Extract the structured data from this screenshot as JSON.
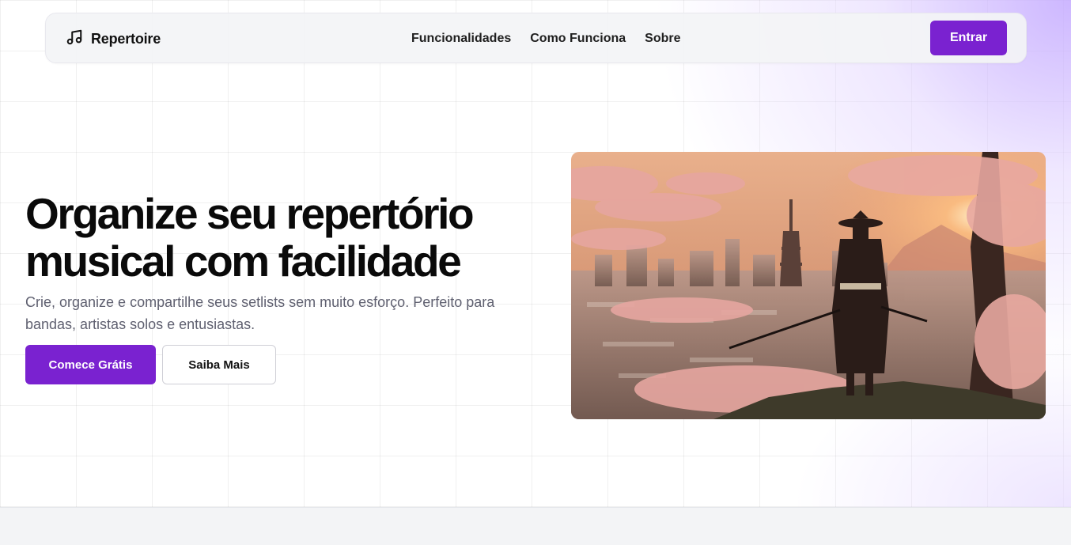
{
  "navbar": {
    "brand_icon": "music-note-icon",
    "brand_name": "Repertoire",
    "links": [
      {
        "label": "Funcionalidades"
      },
      {
        "label": "Como Funciona"
      },
      {
        "label": "Sobre"
      }
    ],
    "login_label": "Entrar"
  },
  "hero": {
    "headline_line1": "Organize seu repertório",
    "headline_line2": "musical com facilidade",
    "subtitle": "Crie, organize e compartilhe seus setlists sem muito esforço. Perfeito para bandas, artistas solos e entusiastas.",
    "primary_cta": "Comece Grátis",
    "secondary_cta": "Saiba Mais",
    "image_subject": "samurai-cherry-blossom-city-illustration"
  },
  "colors": {
    "accent": "#7a22d0",
    "text_dark": "#0a0a0a",
    "text_muted": "#5f6070"
  }
}
